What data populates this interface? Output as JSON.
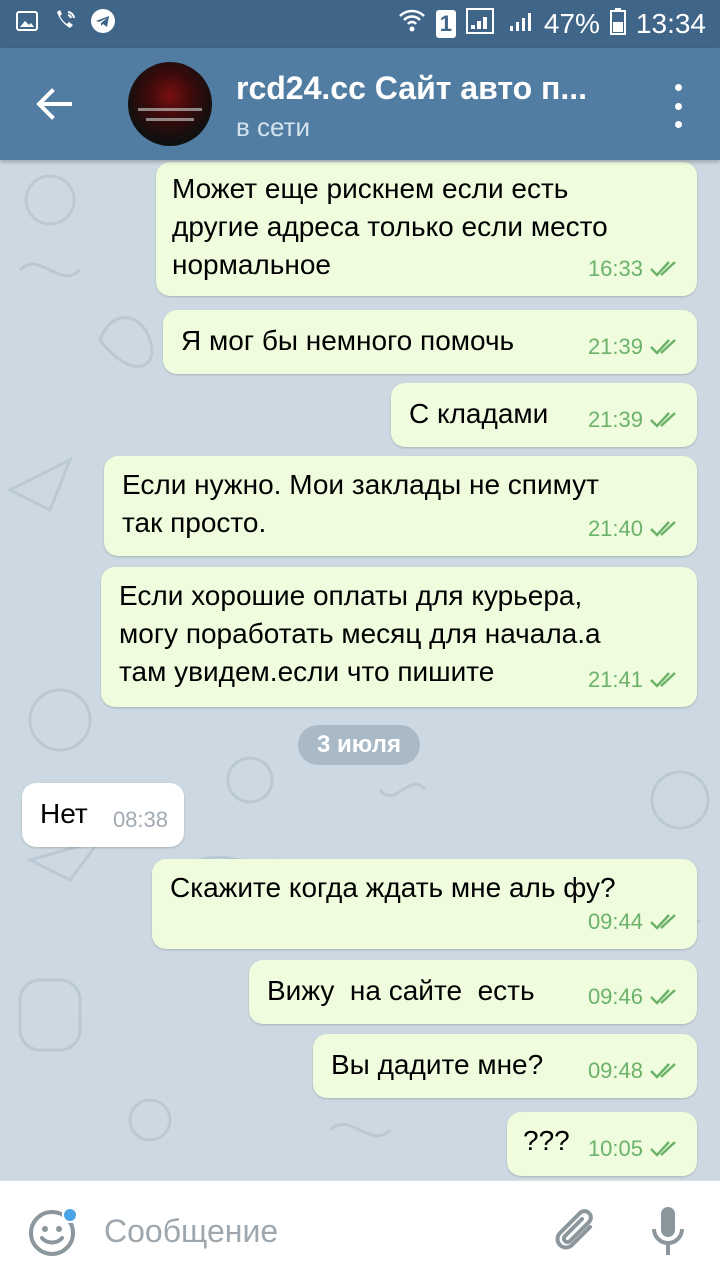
{
  "statusbar": {
    "left_icons": [
      "image-icon",
      "wifi-call-icon",
      "telegram-icon"
    ],
    "sim_label": "1",
    "battery": "47%",
    "time": "13:34"
  },
  "header": {
    "title": "rcd24.cc Сайт авто п...",
    "status": "в сети"
  },
  "messages": [
    {
      "dir": "out",
      "lines": "Может еще рискнем если есть\nдругие адреса только если место\nнормальное",
      "time": "16:33"
    },
    {
      "dir": "out",
      "lines": "Я мог бы немного помочь",
      "time": "21:39"
    },
    {
      "dir": "out",
      "lines": "С кладами",
      "time": "21:39"
    },
    {
      "dir": "out",
      "lines": "Если нужно. Мои заклады не спимут\nтак просто.",
      "time": "21:40"
    },
    {
      "dir": "out",
      "lines": "Если хорошие оплаты для курьера,\nмогу поработать месяц для начала.а\nтам увидем.если что пишите",
      "time": "21:41"
    },
    {
      "dir": "in",
      "lines": "Нет",
      "time": "08:38"
    },
    {
      "dir": "out",
      "lines": "Скажите когда ждать мне аль фу?",
      "time": "09:44"
    },
    {
      "dir": "out",
      "lines": "Вижу  на сайте  есть",
      "time": "09:46"
    },
    {
      "dir": "out",
      "lines": "Вы дадите мне?",
      "time": "09:48"
    },
    {
      "dir": "out",
      "lines": "???",
      "time": "10:05"
    }
  ],
  "date_separator": "3 июля",
  "input": {
    "placeholder": "Сообщение"
  },
  "colors": {
    "header": "#527da3",
    "statusbar": "#3f6588",
    "outgoing_bubble": "#effdde",
    "incoming_bubble": "#ffffff",
    "check": "#6cb26a"
  }
}
